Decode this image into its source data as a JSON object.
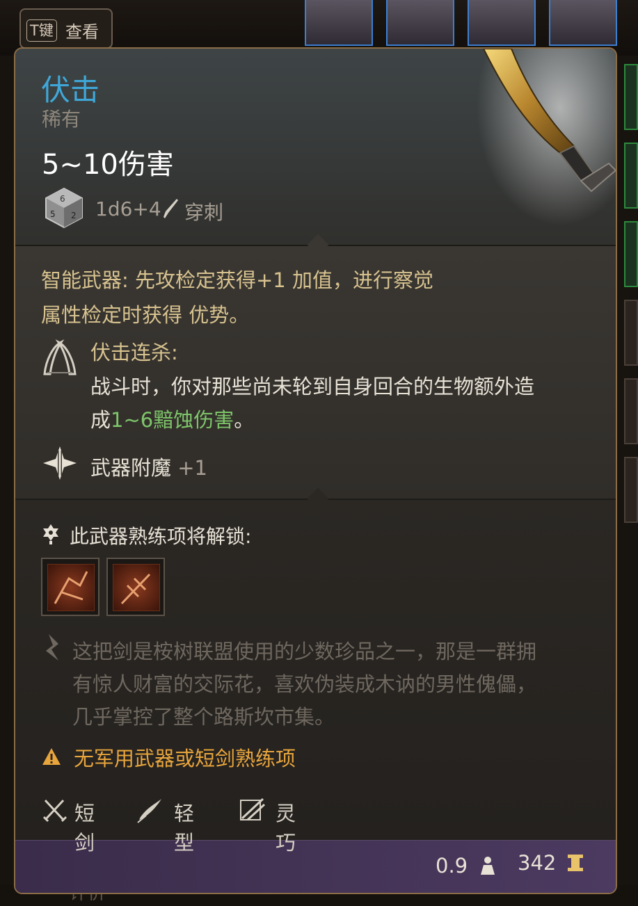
{
  "hint": {
    "key": "T键",
    "label": "查看"
  },
  "item": {
    "name": "伏击",
    "rarity": "稀有",
    "damage": "5~10伤害",
    "dice": "1d6+4",
    "damage_type": "穿刺"
  },
  "smart_weapon": {
    "line1": "智能武器: 先攻检定获得+1 加值，进行察觉",
    "line2": "属性检定时获得 优势。"
  },
  "ability": {
    "title": "伏击连杀:",
    "desc_1": "战斗时，你对那些尚未轮到自身回合的生物额外造",
    "desc_2_prefix": "成",
    "desc_2_highlight": "1~6黯蚀伤害",
    "desc_2_suffix": "。"
  },
  "enchant": {
    "label": "武器附魔",
    "bonus": "+1"
  },
  "proficiency": {
    "label": "此武器熟练项将解锁:"
  },
  "lore": {
    "line1": "这把剑是桉树联盟使用的少数珍品之一，那是一群拥",
    "line2": "有惊人财富的交际花，喜欢伪装成木讷的男性傀儡，",
    "line3": "几乎掌控了整个路斯坎市集。"
  },
  "warning": "无军用武器或短剑熟练项",
  "properties": [
    "短剑",
    "轻型",
    "灵巧"
  ],
  "footer": {
    "weight": "0.9",
    "value": "342"
  },
  "background": {
    "bottom_text": "评价"
  },
  "colors": {
    "name": "#3fa7d8",
    "highlight": "#7ec56a",
    "warning": "#e8a53c",
    "passive": "#d8c38f",
    "footer": "#4c3a60"
  },
  "icons": [
    "dice-icon",
    "pierce-icon",
    "ambush-ability-icon",
    "enchant-icon",
    "unlock-icon",
    "proficiency-icon",
    "proficiency-icon-2",
    "lore-icon",
    "warning-icon",
    "shortsword-icon",
    "light-icon",
    "finesse-icon",
    "weight-icon",
    "gold-icon"
  ]
}
